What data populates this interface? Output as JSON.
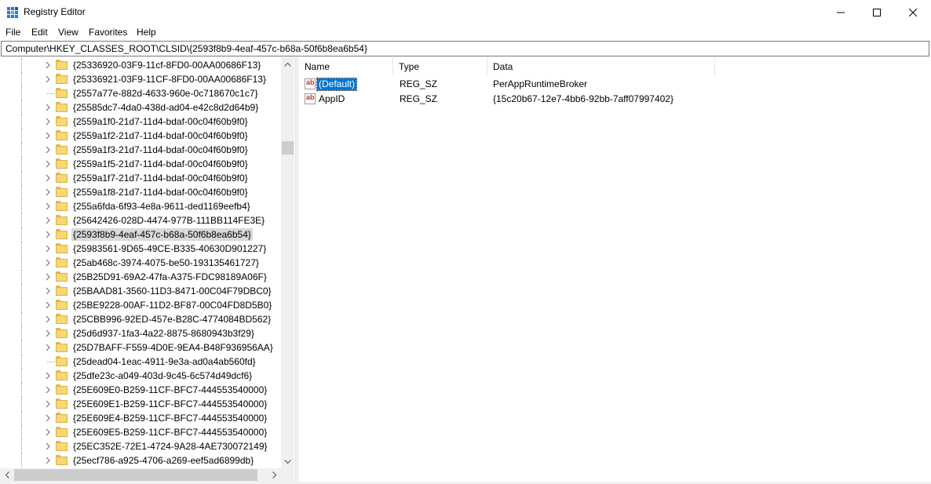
{
  "window": {
    "title": "Registry Editor",
    "minimize_label": "—",
    "maximize_label": "☐",
    "close_label": "✕"
  },
  "menu": [
    "File",
    "Edit",
    "View",
    "Favorites",
    "Help"
  ],
  "address": "Computer\\HKEY_CLASSES_ROOT\\CLSID\\{2593f8b9-4eaf-457c-b68a-50f6b8ea6b54}",
  "tree": {
    "items": [
      {
        "label": "{25336920-03F9-11cf-8FD0-00AA00686F13}",
        "expandable": true,
        "selected": false
      },
      {
        "label": "{25336921-03F9-11CF-8FD0-00AA00686F13}",
        "expandable": true,
        "selected": false
      },
      {
        "label": "{2557a77e-882d-4633-960e-0c718670c1c7}",
        "expandable": false,
        "selected": false
      },
      {
        "label": "{25585dc7-4da0-438d-ad04-e42c8d2d64b9}",
        "expandable": true,
        "selected": false
      },
      {
        "label": "{2559a1f0-21d7-11d4-bdaf-00c04f60b9f0}",
        "expandable": true,
        "selected": false
      },
      {
        "label": "{2559a1f2-21d7-11d4-bdaf-00c04f60b9f0}",
        "expandable": true,
        "selected": false
      },
      {
        "label": "{2559a1f3-21d7-11d4-bdaf-00c04f60b9f0}",
        "expandable": true,
        "selected": false
      },
      {
        "label": "{2559a1f5-21d7-11d4-bdaf-00c04f60b9f0}",
        "expandable": true,
        "selected": false
      },
      {
        "label": "{2559a1f7-21d7-11d4-bdaf-00c04f60b9f0}",
        "expandable": true,
        "selected": false
      },
      {
        "label": "{2559a1f8-21d7-11d4-bdaf-00c04f60b9f0}",
        "expandable": true,
        "selected": false
      },
      {
        "label": "{255a6fda-6f93-4e8a-9611-ded1169eefb4}",
        "expandable": true,
        "selected": false
      },
      {
        "label": "{25642426-028D-4474-977B-111BB114FE3E}",
        "expandable": true,
        "selected": false
      },
      {
        "label": "{2593f8b9-4eaf-457c-b68a-50f6b8ea6b54}",
        "expandable": true,
        "selected": true
      },
      {
        "label": "{25983561-9D65-49CE-B335-40630D901227}",
        "expandable": true,
        "selected": false
      },
      {
        "label": "{25ab468c-3974-4075-be50-193135461727}",
        "expandable": true,
        "selected": false
      },
      {
        "label": "{25B25D91-69A2-47fa-A375-FDC98189A06F}",
        "expandable": true,
        "selected": false
      },
      {
        "label": "{25BAAD81-3560-11D3-8471-00C04F79DBC0}",
        "expandable": true,
        "selected": false
      },
      {
        "label": "{25BE9228-00AF-11D2-BF87-00C04FD8D5B0}",
        "expandable": true,
        "selected": false
      },
      {
        "label": "{25CBB996-92ED-457e-B28C-4774084BD562}",
        "expandable": true,
        "selected": false
      },
      {
        "label": "{25d6d937-1fa3-4a22-8875-8680943b3f29}",
        "expandable": true,
        "selected": false
      },
      {
        "label": "{25D7BAFF-F559-4D0E-9EA4-B48F936956AA}",
        "expandable": true,
        "selected": false
      },
      {
        "label": "{25dead04-1eac-4911-9e3a-ad0a4ab560fd}",
        "expandable": false,
        "selected": false
      },
      {
        "label": "{25dfe23c-a049-403d-9c45-6c574d49dcf6}",
        "expandable": true,
        "selected": false
      },
      {
        "label": "{25E609E0-B259-11CF-BFC7-444553540000}",
        "expandable": true,
        "selected": false
      },
      {
        "label": "{25E609E1-B259-11CF-BFC7-444553540000}",
        "expandable": true,
        "selected": false
      },
      {
        "label": "{25E609E4-B259-11CF-BFC7-444553540000}",
        "expandable": true,
        "selected": false
      },
      {
        "label": "{25E609E5-B259-11CF-BFC7-444553540000}",
        "expandable": true,
        "selected": false
      },
      {
        "label": "{25EC352E-72E1-4724-9A28-4AE730072149}",
        "expandable": true,
        "selected": false
      },
      {
        "label": "{25ecf786-a925-4706-a269-eef5ad6899db}",
        "expandable": true,
        "selected": false
      }
    ]
  },
  "list": {
    "headers": {
      "name": "Name",
      "type": "Type",
      "data": "Data"
    },
    "rows": [
      {
        "name": "(Default)",
        "type": "REG_SZ",
        "data": "PerAppRuntimeBroker",
        "selected": true,
        "icon": "string-value-icon"
      },
      {
        "name": "AppID",
        "type": "REG_SZ",
        "data": "{15c20b67-12e7-4bb6-92bb-7aff07997402}",
        "selected": false,
        "icon": "string-value-icon"
      }
    ],
    "icon_text": "ab"
  },
  "colors": {
    "selection": "#0078d7",
    "tree_selection": "#d9d9d9",
    "folder": "#f8d775"
  }
}
